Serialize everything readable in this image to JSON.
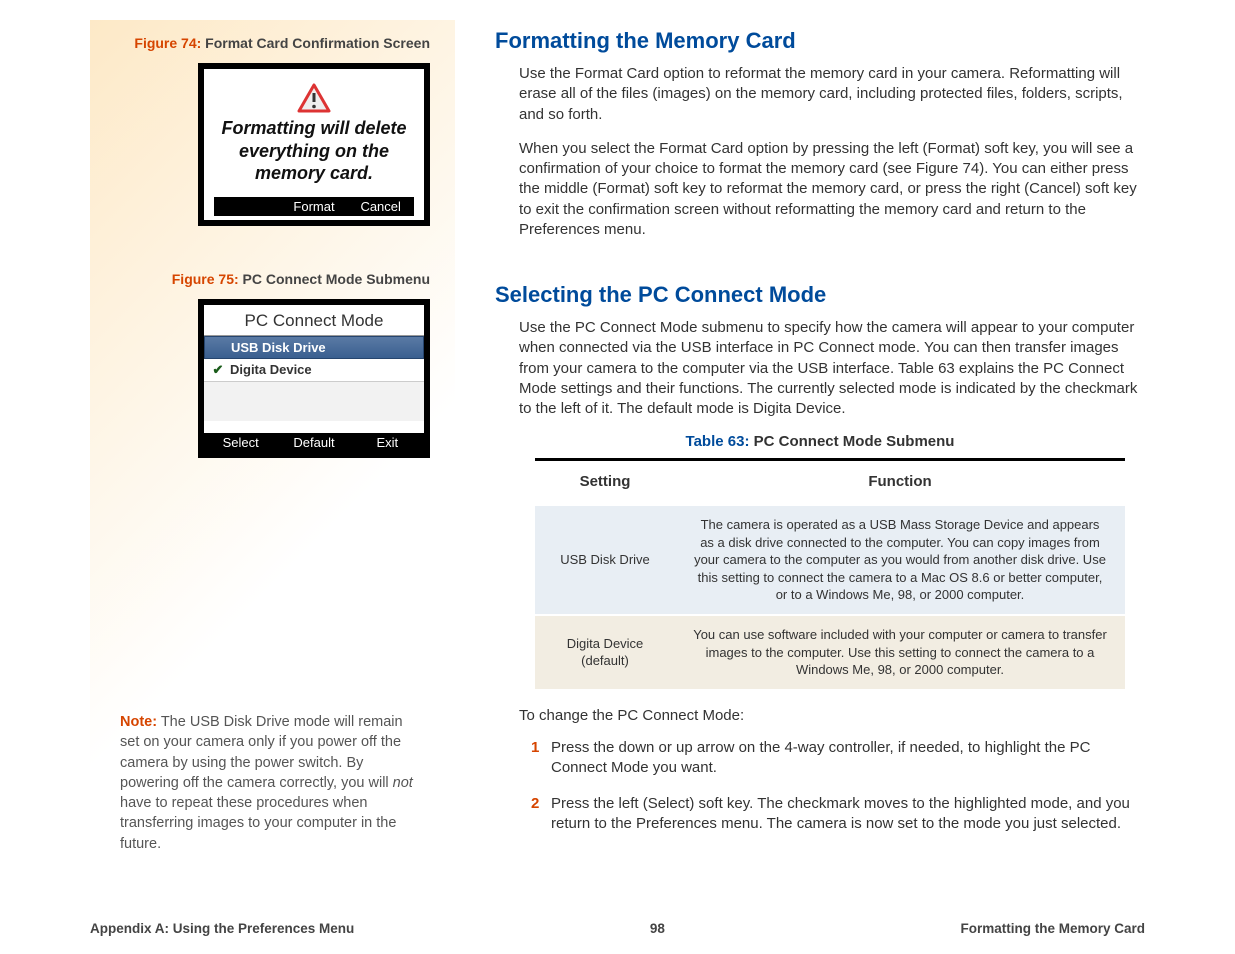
{
  "sidebar": {
    "figure74": {
      "label_prefix": "Figure 74:",
      "label_text": " Format Card Confirmation Screen",
      "lcd_text": "Formatting will delete everything on the memory card.",
      "softkeys": {
        "left": "",
        "mid": "Format",
        "right": "Cancel"
      }
    },
    "figure75": {
      "label_prefix": "Figure 75:",
      "label_text": " PC Connect Mode Submenu",
      "title": "PC Connect Mode",
      "row1": "USB Disk Drive",
      "row2_check": "✔",
      "row2": "Digita Device",
      "softkeys": {
        "left": "Select",
        "mid": "Default",
        "right": "Exit"
      }
    },
    "note": {
      "label": "Note:",
      "text_a": " The USB Disk Drive mode will remain set on your camera only if you power off the camera by using the power switch. By powering off the camera correctly, you will ",
      "em": "not",
      "text_b": " have to repeat these procedures when transferring images to your computer in the future."
    }
  },
  "main": {
    "section1": {
      "heading": "Formatting the Memory Card",
      "p1": "Use the Format Card option to reformat the memory card in your camera. Reformatting will erase all of the files (images) on the memory card, including protected files, folders, scripts, and so forth.",
      "p2": "When you select the Format Card option by pressing the left (Format) soft key, you will see a confirmation of your choice to format the memory card (see Figure 74). You can either press the middle (Format) soft key to reformat the memory card, or press the right (Cancel) soft key to exit the confirmation screen without reformatting the memory card and return to the Preferences menu."
    },
    "section2": {
      "heading": "Selecting the PC Connect Mode",
      "p1": "Use the PC Connect Mode submenu to specify how the camera will appear to your computer when connected via the USB interface in PC Connect mode. You can then transfer images from your camera to the computer via the USB interface. Table 63 explains the PC Connect Mode settings and their functions. The currently selected mode is indicated by the checkmark to the left of it. The default mode is Digita Device.",
      "table": {
        "caption_prefix": "Table 63:",
        "caption_text": " PC Connect Mode Submenu",
        "headers": {
          "c1": "Setting",
          "c2": "Function"
        },
        "rows": [
          {
            "setting": "USB Disk Drive",
            "function": "The camera is operated as a USB Mass Storage Device and appears as a disk drive connected to the computer. You can copy images from your camera to the computer as you would from another disk drive. Use this setting to connect the camera to a Mac OS 8.6 or better computer, or to a Windows Me, 98, or 2000 computer."
          },
          {
            "setting": "Digita Device (default)",
            "function": "You can use software included with your computer or camera to transfer images to the computer. Use this setting to connect the camera to a Windows Me, 98, or 2000 computer."
          }
        ]
      },
      "change_lead": "To change the PC Connect Mode:",
      "steps": [
        {
          "n": "1",
          "t": "Press the down or up arrow on the 4-way controller, if needed, to highlight the PC Connect Mode you want."
        },
        {
          "n": "2",
          "t": "Press the left (Select) soft key. The checkmark moves to the highlighted mode, and you return to the Preferences menu. The camera is now set to the mode you just selected."
        }
      ]
    }
  },
  "footer": {
    "left": "Appendix A: Using the Preferences Menu",
    "center": "98",
    "right": "Formatting the Memory Card"
  }
}
